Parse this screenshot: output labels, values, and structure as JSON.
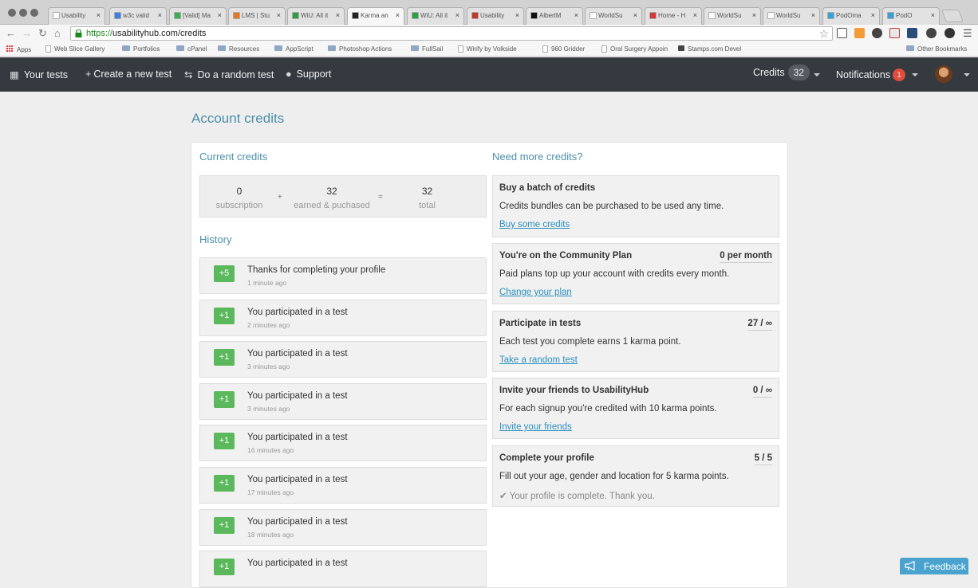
{
  "browser": {
    "tabs": [
      {
        "title": "Usability",
        "color": "#ffffff"
      },
      {
        "title": "w3c valid",
        "color": "#3f7fe0"
      },
      {
        "title": "[Valid] Ma",
        "color": "#3cae54"
      },
      {
        "title": "LMS | Stu",
        "color": "#e8761b"
      },
      {
        "title": "WiU: All it",
        "color": "#2ea043"
      },
      {
        "title": "Karma an",
        "color": "#222222"
      },
      {
        "title": "WiU: All it",
        "color": "#2ea043"
      },
      {
        "title": "Usability",
        "color": "#c0392b"
      },
      {
        "title": "AlbertM",
        "color": "#111111"
      },
      {
        "title": "WorldSu",
        "color": "#ffffff"
      },
      {
        "title": "Home - H",
        "color": "#d9383a"
      },
      {
        "title": "WorldSu",
        "color": "#ffffff"
      },
      {
        "title": "WorldSu",
        "color": "#ffffff"
      },
      {
        "title": "PodOma",
        "color": "#3aa1d6"
      },
      {
        "title": "PodO",
        "color": "#3aa1d6"
      }
    ],
    "url_scheme": "https://",
    "url_rest": "usabilityhub.com/credits",
    "bookmarks": [
      {
        "label": "Apps",
        "icon": "apps"
      },
      {
        "label": "Web Slice Gallery",
        "icon": "page"
      },
      {
        "label": "Portfolios",
        "icon": "folder"
      },
      {
        "label": "cPanel",
        "icon": "folder"
      },
      {
        "label": "Resources",
        "icon": "folder"
      },
      {
        "label": "AppScript",
        "icon": "folder"
      },
      {
        "label": "Photoshop Actions",
        "icon": "folder"
      },
      {
        "label": "FullSail",
        "icon": "folder"
      },
      {
        "label": "Wirify by Volkside",
        "icon": "page"
      },
      {
        "label": "960 Gridder",
        "icon": "page"
      },
      {
        "label": "Oral Surgery Appoin",
        "icon": "page"
      },
      {
        "label": "Stamps.com Devel",
        "icon": "tag"
      }
    ],
    "other_bookmarks": "Other Bookmarks"
  },
  "nav": {
    "your_tests": "Your tests",
    "create_test": "Create a new test",
    "random_test": "Do a random test",
    "support": "Support",
    "credits_label": "Credits",
    "credits_count": "32",
    "notifications_label": "Notifications",
    "notifications_count": "1"
  },
  "page": {
    "title": "Account credits"
  },
  "current_credits": {
    "heading": "Current credits",
    "subscription_value": "0",
    "subscription_label": "subscription",
    "plus": "+",
    "earned_value": "32",
    "earned_label": "earned & puchased",
    "equals": "=",
    "total_value": "32",
    "total_label": "total"
  },
  "history": {
    "heading": "History",
    "items": [
      {
        "badge": "+5",
        "text": "Thanks for completing your profile",
        "time": "1 minute ago"
      },
      {
        "badge": "+1",
        "text": "You participated in a test",
        "time": "2 minutes ago"
      },
      {
        "badge": "+1",
        "text": "You participated in a test",
        "time": "3 minutes ago"
      },
      {
        "badge": "+1",
        "text": "You participated in a test",
        "time": "3 minutes ago"
      },
      {
        "badge": "+1",
        "text": "You participated in a test",
        "time": "16 minutes ago"
      },
      {
        "badge": "+1",
        "text": "You participated in a test",
        "time": "17 minutes ago"
      },
      {
        "badge": "+1",
        "text": "You participated in a test",
        "time": "18 minutes ago"
      },
      {
        "badge": "+1",
        "text": "You participated in a test",
        "time": ""
      }
    ]
  },
  "more_credits": {
    "heading": "Need more credits?",
    "cards": [
      {
        "title": "Buy a batch of credits",
        "stat": "",
        "desc": "Credits bundles can be purchased to be used any time.",
        "link": "Buy some credits"
      },
      {
        "title": "You're on the Community Plan",
        "stat": "0 per month",
        "desc": "Paid plans top up your account with credits every month.",
        "link": "Change your plan"
      },
      {
        "title": "Participate in tests",
        "stat": "27 / ∞",
        "desc": "Each test you complete earns 1 karma point.",
        "link": "Take a random test"
      },
      {
        "title": "Invite your friends to UsabilityHub",
        "stat": "0 / ∞",
        "desc": "For each signup you're credited with 10 karma points.",
        "link": "Invite your friends"
      },
      {
        "title": "Complete your profile",
        "stat": "5 / 5",
        "desc": "Fill out your age, gender and location for 5 karma points.",
        "done": "✔ Your profile is complete. Thank you."
      }
    ]
  },
  "feedback_label": "Feedback"
}
